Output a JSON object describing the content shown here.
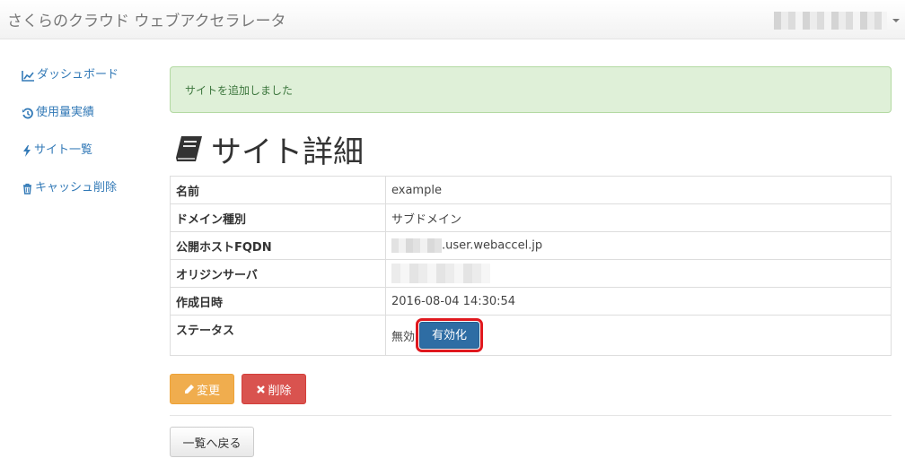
{
  "app": {
    "brand": "さくらのクラウド ウェブアクセラレータ"
  },
  "sidebar": {
    "items": [
      {
        "label": "ダッシュボード",
        "icon": "line-chart-icon"
      },
      {
        "label": "使用量実績",
        "icon": "history-icon"
      },
      {
        "label": "サイト一覧",
        "icon": "bolt-icon"
      },
      {
        "label": "キャッシュ削除",
        "icon": "trash-icon"
      }
    ]
  },
  "alert": {
    "message": "サイトを追加しました"
  },
  "page": {
    "title": "サイト詳細",
    "title_icon": "book-icon"
  },
  "details": {
    "name_label": "名前",
    "name_value": "example",
    "domain_type_label": "ドメイン種別",
    "domain_type_value": "サブドメイン",
    "fqdn_label": "公開ホストFQDN",
    "fqdn_suffix": ".user.webaccel.jp",
    "origin_label": "オリジンサーバ",
    "created_label": "作成日時",
    "created_value": "2016-08-04 14:30:54",
    "status_label": "ステータス",
    "status_value": "無効",
    "enable_button": "有効化"
  },
  "actions": {
    "edit": "変更",
    "delete": "削除",
    "back": "一覧へ戻る"
  },
  "colors": {
    "link": "#337ab7",
    "success_bg": "#dff0d8",
    "primary": "#2e6da4",
    "warning": "#f0ad4e",
    "danger": "#d9534f",
    "highlight": "#e0181e"
  }
}
